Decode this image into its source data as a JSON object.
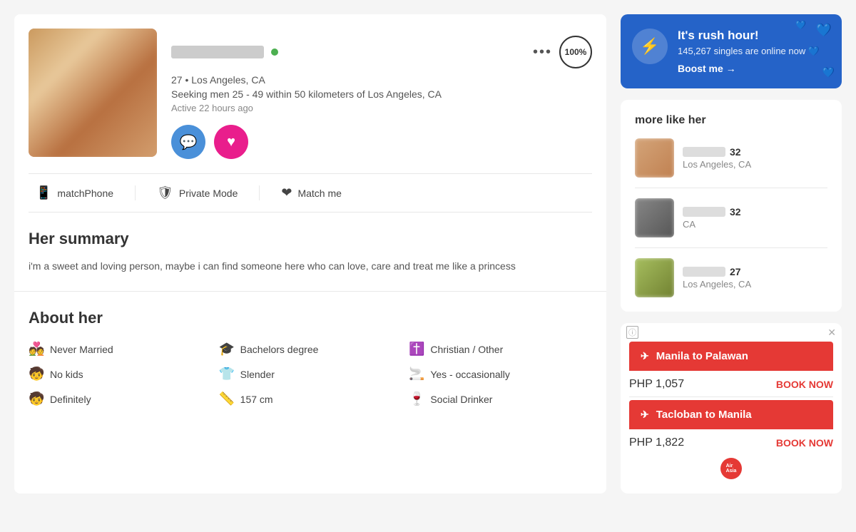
{
  "profile": {
    "name_blur": true,
    "age": "27",
    "location": "Los Angeles, CA",
    "seeking": "Seeking men 25 - 49 within 50 kilometers of Los Angeles, CA",
    "active": "Active 22 hours ago",
    "percent": "100%",
    "online": true
  },
  "features": {
    "match_phone": "matchPhone",
    "private_mode": "Private Mode",
    "match_me": "Match me"
  },
  "summary": {
    "title": "Her summary",
    "text": "i'm a sweet and loving person, maybe i can find someone here who can love, care and treat me like a princess"
  },
  "about": {
    "title": "About her",
    "items": [
      {
        "icon": "💑",
        "label": "Never Married"
      },
      {
        "icon": "🎓",
        "label": "Bachelors degree"
      },
      {
        "icon": "✝️",
        "label": "Christian / Other"
      },
      {
        "icon": "👶",
        "label": "No kids"
      },
      {
        "icon": "👕",
        "label": "Slender"
      },
      {
        "icon": "🚬",
        "label": "Yes - occasionally"
      },
      {
        "icon": "👶",
        "label": "Definitely",
        "blue": true
      },
      {
        "icon": "📏",
        "label": "157 cm"
      },
      {
        "icon": "🍷",
        "label": "Social Drinker"
      }
    ]
  },
  "rush": {
    "title": "It's rush hour!",
    "subtitle": "145,267 singles are online now",
    "boost": "Boost me →",
    "emoji": "💙"
  },
  "more_like_her": {
    "title": "more like her",
    "profiles": [
      {
        "age": "32",
        "location": "Los Angeles, CA"
      },
      {
        "age": "32",
        "location": "CA"
      },
      {
        "age": "27",
        "location": "Los Angeles, CA"
      }
    ]
  },
  "ad": {
    "routes": [
      {
        "from": "Manila",
        "to": "Palawan",
        "price": "PHP 1,057",
        "book": "BOOK NOW"
      },
      {
        "from": "Tacloban",
        "to": "Manila",
        "price": "PHP 1,822",
        "book": "BOOK NOW"
      }
    ],
    "logo_text": "AirAsia"
  },
  "icons": {
    "message": "💬",
    "heart": "♥",
    "bolt": "⚡",
    "plane": "✈",
    "more": "•••",
    "phone": "📞",
    "shield": "🛡",
    "match_heart": "❤"
  }
}
